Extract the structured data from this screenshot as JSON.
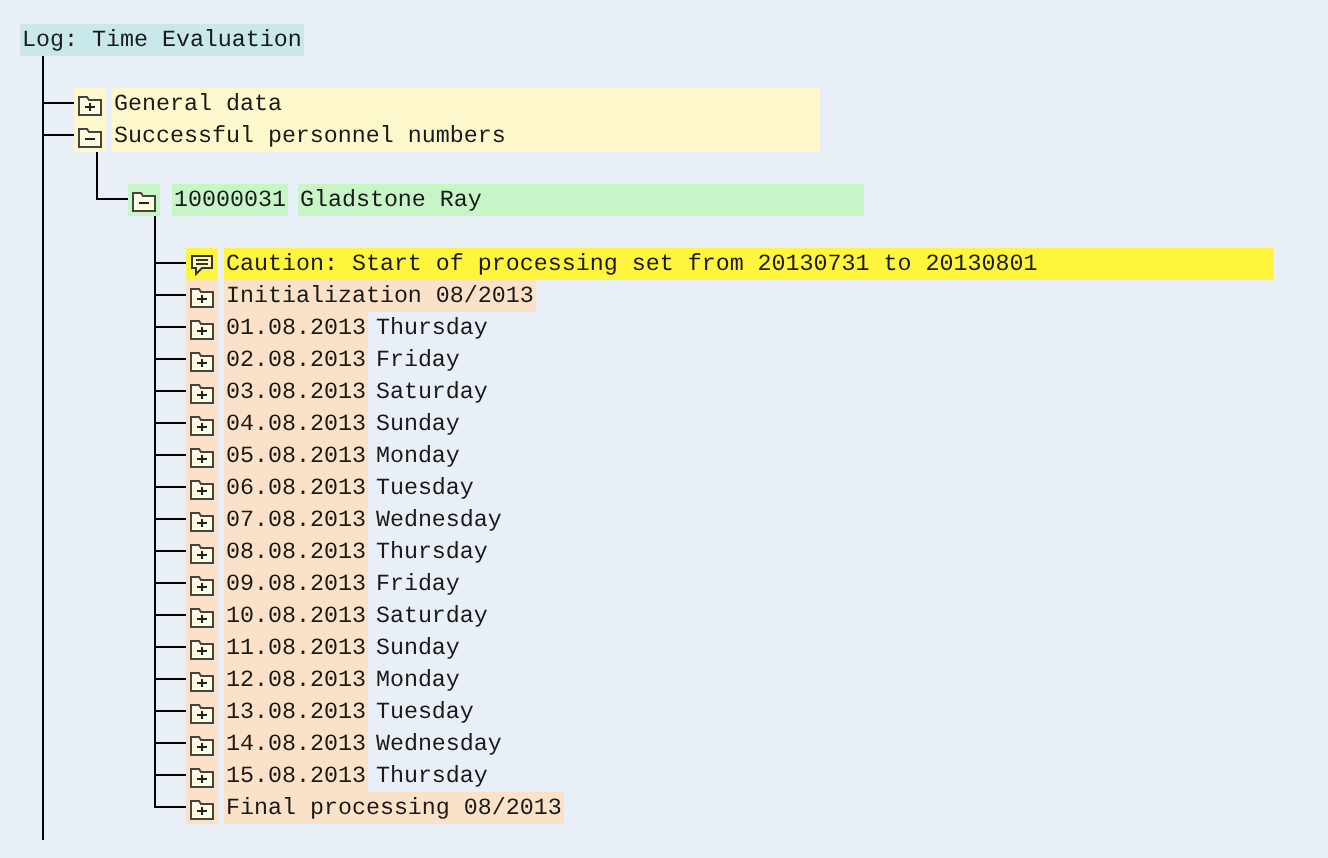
{
  "root": {
    "cells": [
      "Log: Time Evaluation"
    ],
    "children": [
      {
        "kind": "group",
        "expanded": false,
        "cells": [
          "General data"
        ]
      },
      {
        "kind": "group",
        "expanded": true,
        "cells": [
          "Successful personnel numbers"
        ],
        "children": [
          {
            "kind": "personnel",
            "expanded": true,
            "cells": [
              "10000031",
              "Gladstone Ray"
            ],
            "children": [
              {
                "kind": "message",
                "cells": [
                  "Caution: Start of processing set from 20130731 to 20130801"
                ]
              },
              {
                "kind": "period",
                "expanded": false,
                "cells": [
                  "Initialization 08/2013"
                ]
              },
              {
                "kind": "day",
                "expanded": false,
                "cells": [
                  "01.08.2013",
                  "Thursday"
                ]
              },
              {
                "kind": "day",
                "expanded": false,
                "cells": [
                  "02.08.2013",
                  "Friday"
                ]
              },
              {
                "kind": "day",
                "expanded": false,
                "cells": [
                  "03.08.2013",
                  "Saturday"
                ]
              },
              {
                "kind": "day",
                "expanded": false,
                "cells": [
                  "04.08.2013",
                  "Sunday"
                ]
              },
              {
                "kind": "day",
                "expanded": false,
                "cells": [
                  "05.08.2013",
                  "Monday"
                ]
              },
              {
                "kind": "day",
                "expanded": false,
                "cells": [
                  "06.08.2013",
                  "Tuesday"
                ]
              },
              {
                "kind": "day",
                "expanded": false,
                "cells": [
                  "07.08.2013",
                  "Wednesday"
                ]
              },
              {
                "kind": "day",
                "expanded": false,
                "cells": [
                  "08.08.2013",
                  "Thursday"
                ]
              },
              {
                "kind": "day",
                "expanded": false,
                "cells": [
                  "09.08.2013",
                  "Friday"
                ]
              },
              {
                "kind": "day",
                "expanded": false,
                "cells": [
                  "10.08.2013",
                  "Saturday"
                ]
              },
              {
                "kind": "day",
                "expanded": false,
                "cells": [
                  "11.08.2013",
                  "Sunday"
                ]
              },
              {
                "kind": "day",
                "expanded": false,
                "cells": [
                  "12.08.2013",
                  "Monday"
                ]
              },
              {
                "kind": "day",
                "expanded": false,
                "cells": [
                  "13.08.2013",
                  "Tuesday"
                ]
              },
              {
                "kind": "day",
                "expanded": false,
                "cells": [
                  "14.08.2013",
                  "Wednesday"
                ]
              },
              {
                "kind": "day",
                "expanded": false,
                "cells": [
                  "15.08.2013",
                  "Thursday"
                ]
              },
              {
                "kind": "period",
                "expanded": false,
                "cells": [
                  "Final processing 08/2013"
                ]
              }
            ]
          }
        ]
      }
    ]
  }
}
